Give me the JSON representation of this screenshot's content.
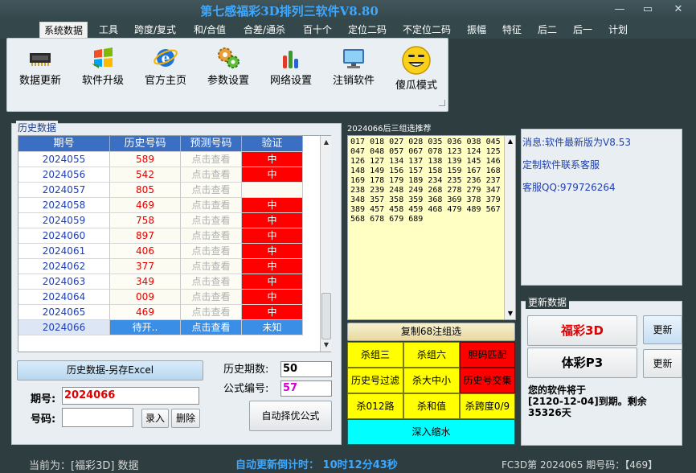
{
  "window": {
    "title": "第七感福彩3D排列三软件V8.80",
    "min": "—",
    "max": "▭",
    "close": "✕"
  },
  "menu": [
    "系统数据",
    "工具",
    "跨度/复式",
    "和/合值",
    "合差/通杀",
    "百十个",
    "定位二码",
    "不定位二码",
    "振幅",
    "特征",
    "后二",
    "后一",
    "计划"
  ],
  "toolbar": [
    "数据更新",
    "软件升级",
    "官方主页",
    "参数设置",
    "网络设置",
    "注销软件",
    "傻瓜模式"
  ],
  "history": {
    "section_title": "历史数据",
    "headers": [
      "期号",
      "历史号码",
      "预测号码",
      "验证"
    ],
    "rows": [
      {
        "period": "2024055",
        "number": "589",
        "predict": "点击查看",
        "verify": "中"
      },
      {
        "period": "2024056",
        "number": "542",
        "predict": "点击查看",
        "verify": "中"
      },
      {
        "period": "2024057",
        "number": "805",
        "predict": "点击查看",
        "verify": ""
      },
      {
        "period": "2024058",
        "number": "469",
        "predict": "点击查看",
        "verify": "中"
      },
      {
        "period": "2024059",
        "number": "758",
        "predict": "点击查看",
        "verify": "中"
      },
      {
        "period": "2024060",
        "number": "897",
        "predict": "点击查看",
        "verify": "中"
      },
      {
        "period": "2024061",
        "number": "406",
        "predict": "点击查看",
        "verify": "中"
      },
      {
        "period": "2024062",
        "number": "377",
        "predict": "点击查看",
        "verify": "中"
      },
      {
        "period": "2024063",
        "number": "349",
        "predict": "点击查看",
        "verify": "中"
      },
      {
        "period": "2024064",
        "number": "009",
        "predict": "点击查看",
        "verify": "中"
      },
      {
        "period": "2024065",
        "number": "469",
        "predict": "点击查看",
        "verify": "中"
      },
      {
        "period": "2024066",
        "number": "待开..",
        "predict": "点击查看",
        "verify": "未知"
      }
    ],
    "export_label": "历史数据-另存Excel",
    "period_label": "期号:",
    "period_value": "2024066",
    "code_label": "号码:",
    "code_value": "",
    "enter_label": "录入",
    "delete_label": "删除",
    "count_label": "历史期数:",
    "count_value": "50",
    "formula_label": "公式编号:",
    "formula_value": "57",
    "auto_label": "自动择优公式"
  },
  "recommend": {
    "title": "2024066后三组选推荐",
    "lines": [
      "017 018 027 028 035 036 038 045",
      "047 048 057 067 078 123 124 125",
      "126 127 134 137 138 139 145 146",
      "148 149 156 157 158 159 167 168",
      "169 178 179 189 234 235 236 237",
      "238 239 248 249 268 278 279 347",
      "348 357 358 359 368 369 378 379",
      "389 457 458 459 468 479 489 567",
      "568 678 679 689"
    ],
    "copy_label": "复制68注组选",
    "buttons": [
      {
        "label": "杀组三",
        "color": "yellow"
      },
      {
        "label": "杀组六",
        "color": "yellow"
      },
      {
        "label": "胆码匹配",
        "color": "red"
      },
      {
        "label": "历史号过滤",
        "color": "yellow"
      },
      {
        "label": "杀大中小",
        "color": "yellow"
      },
      {
        "label": "历史号交集",
        "color": "red"
      },
      {
        "label": "杀012路",
        "color": "yellow"
      },
      {
        "label": "杀和值",
        "color": "yellow"
      },
      {
        "label": "杀跨度0/9",
        "color": "yellow"
      }
    ],
    "deep_label": "深入缩水"
  },
  "messages": [
    "消息:软件最新版为V8.53",
    "定制软件联系客服",
    "客服QQ:979726264"
  ],
  "update": {
    "title": "更新数据",
    "fc3d": "福彩3D",
    "p3": "体彩P3",
    "update_label": "更新",
    "expire_text": "您的软件将于\n[2120-12-04]到期。剩余\n35326天"
  },
  "status": {
    "current": "当前为：[福彩3D] 数据",
    "countdown": "自动更新倒计时：  10时12分43秒",
    "info": "FC3D第 2024065 期号码：【469】"
  },
  "colors": {
    "header_blue": "#3a6fc3",
    "hit_red": "#ff0000",
    "highlight_yellow": "#ffff00",
    "cyan": "#00ffff",
    "title_blue": "#3ea8ff"
  }
}
